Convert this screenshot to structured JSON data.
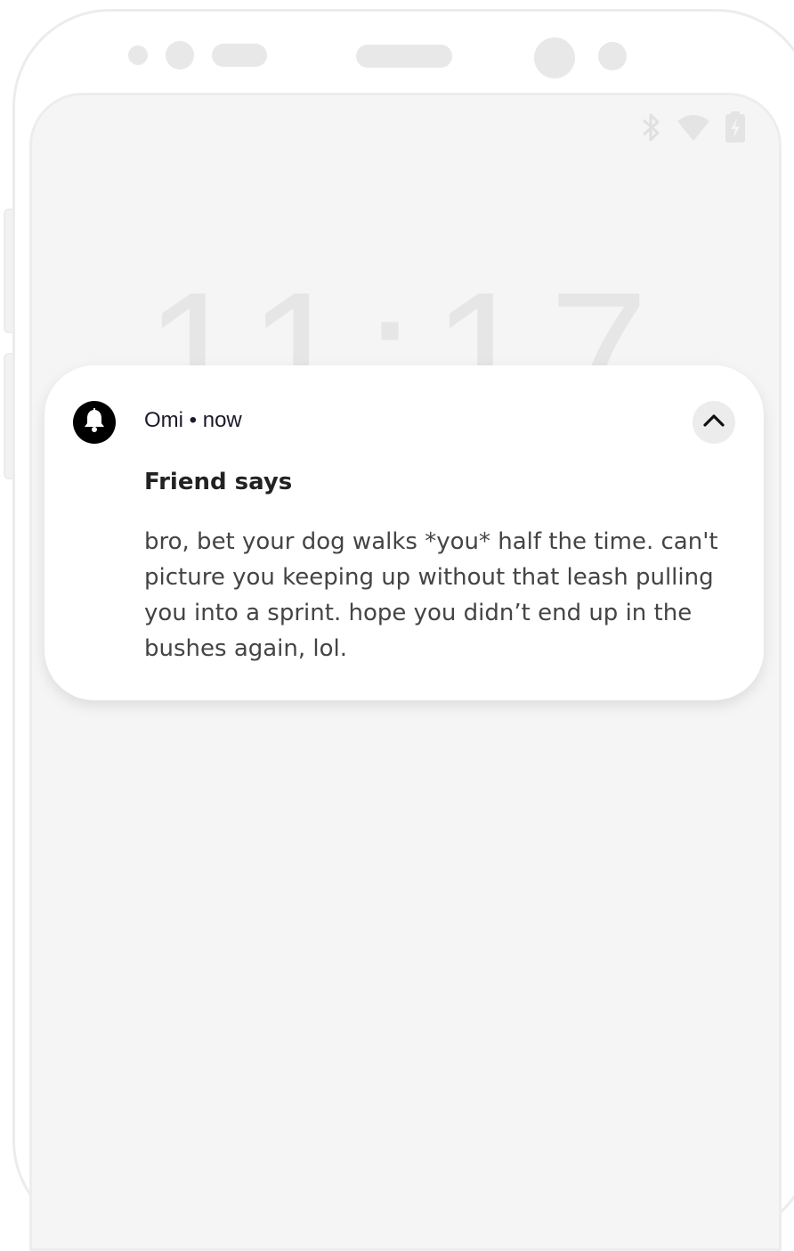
{
  "lock_screen": {
    "clock": "11:17",
    "status_icons": [
      "bluetooth-icon",
      "wifi-icon",
      "battery-charging-icon"
    ]
  },
  "notification": {
    "app_name": "Omi",
    "time": "now",
    "meta": "Omi • now",
    "app_icon": "bell-icon",
    "title": "Friend says",
    "body": "bro, bet your dog walks *you* half the time. can't picture you keeping up without that leash pulling you into a sprint. hope you didn’t end up in the bushes again, lol.",
    "collapse_icon": "chevron-up-icon"
  },
  "colors": {
    "screen_bg": "#f5f5f5",
    "card_bg": "#ffffff",
    "app_icon_bg": "#000000"
  }
}
